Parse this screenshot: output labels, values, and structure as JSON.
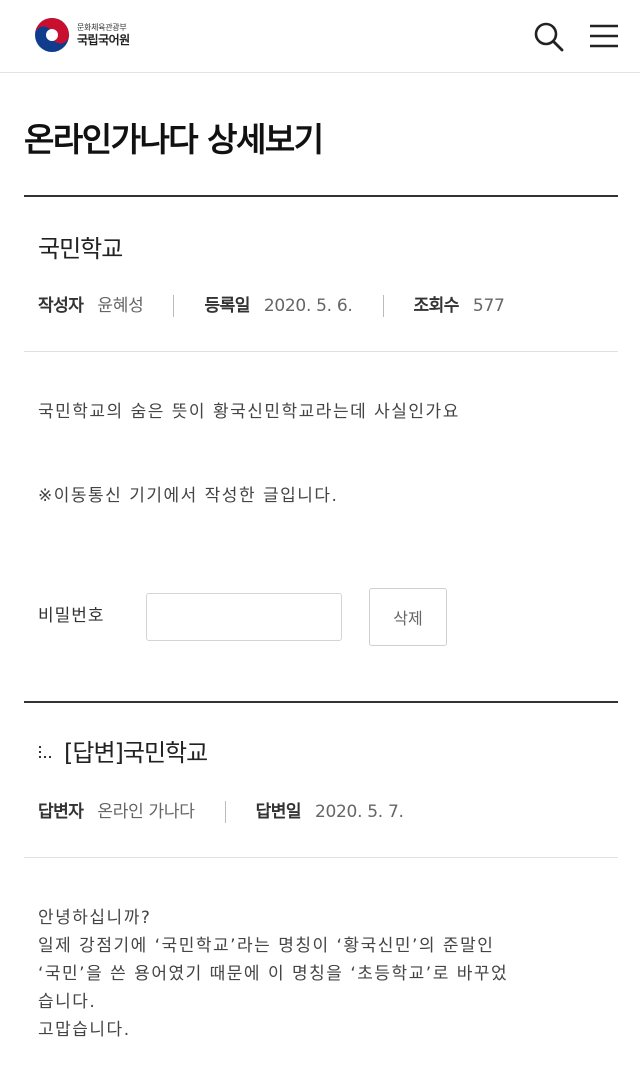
{
  "header": {
    "logo_ministry": "문화체육관광부",
    "logo_org": "국립국어원",
    "search_icon": "search-icon",
    "menu_icon": "hamburger-menu-icon"
  },
  "page": {
    "title": "온라인가나다 상세보기"
  },
  "question": {
    "title": "국민학교",
    "author_label": "작성자",
    "author": "윤혜성",
    "date_label": "등록일",
    "date": "2020. 5. 6.",
    "views_label": "조회수",
    "views": "577",
    "body_line1": "국민학교의 숨은 뜻이 황국신민학교라는데 사실인가요",
    "body_line2": "※이동통신 기기에서 작성한 글입니다.",
    "password_label": "비밀번호",
    "delete_label": "삭제"
  },
  "answer": {
    "title": "[답변]국민학교",
    "answerer_label": "답변자",
    "answerer": "온라인 가나다",
    "date_label": "답변일",
    "date": "2020. 5. 7.",
    "body_lines": [
      "안녕하십니까?",
      "일제 강점기에 ‘국민학교’라는 명칭이 ‘황국신민’의 준말인",
      "‘국민’을 쓴 용어였기 때문에 이 명칭을 ‘초등학교’로 바꾸었",
      "습니다.",
      "고맙습니다."
    ]
  },
  "colors": {
    "logo_red": "#c8102e",
    "logo_blue": "#0f3c8c",
    "rule_dark": "#333333",
    "rule_light": "#e0e0e0"
  }
}
